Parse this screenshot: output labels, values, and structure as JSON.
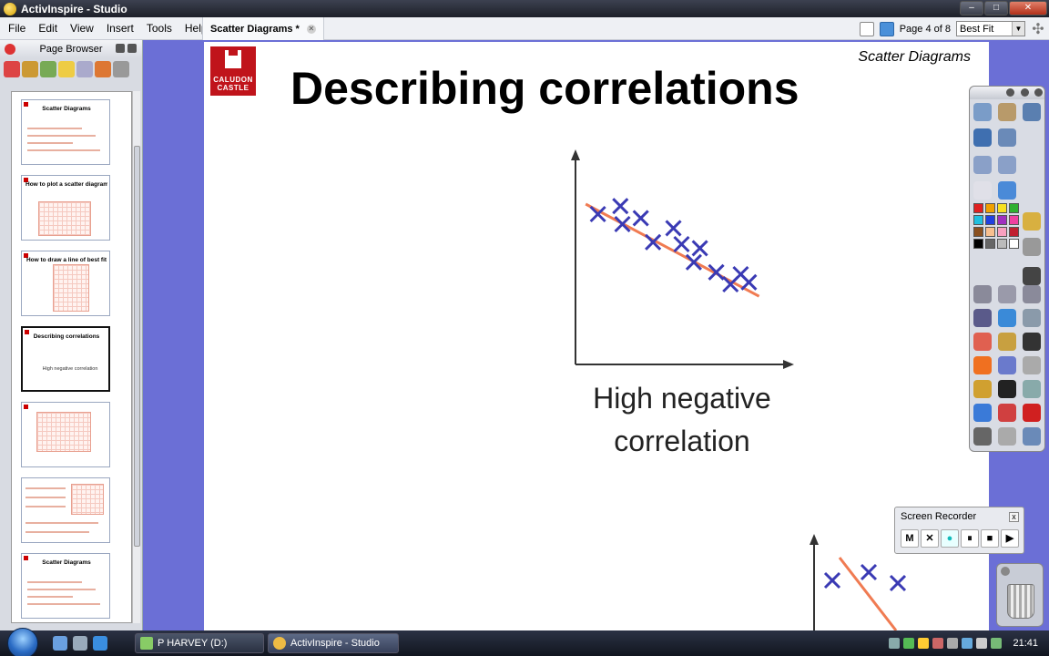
{
  "window": {
    "title": "ActivInspire - Studio"
  },
  "menu": {
    "items": [
      "File",
      "Edit",
      "View",
      "Insert",
      "Tools",
      "Help"
    ]
  },
  "document_tab": {
    "label": "Scatter Diagrams *"
  },
  "page_nav": {
    "label": "Page 4 of 8",
    "zoom": "Best Fit"
  },
  "page_browser": {
    "title": "Page Browser",
    "thumbnails": [
      {
        "title": "Scatter Diagrams"
      },
      {
        "title": "How to plot a scatter diagram"
      },
      {
        "title": "How to draw a line of best fit"
      },
      {
        "title": "Describing correlations",
        "caption": "High negative correlation",
        "active": true
      },
      {
        "title": ""
      },
      {
        "title": ""
      },
      {
        "title": "Scatter Diagrams"
      }
    ]
  },
  "slide": {
    "logo_text": [
      "CALUDON",
      "CASTLE"
    ],
    "header": "Scatter Diagrams",
    "title": "Describing correlations",
    "caption_line1": "High negative",
    "caption_line2": "correlation"
  },
  "chart_data": {
    "type": "scatter",
    "title": "Describing correlations",
    "caption": "High negative correlation",
    "x": [
      1.1,
      2.2,
      2.3,
      3.2,
      3.8,
      4.8,
      5.2,
      5.8,
      6.1,
      6.9,
      7.6,
      8.1,
      8.5
    ],
    "y": [
      7.5,
      7.9,
      7.0,
      7.3,
      6.1,
      6.8,
      6.0,
      5.1,
      5.8,
      4.6,
      4.0,
      4.5,
      4.1
    ],
    "best_fit_line": [
      [
        0.5,
        8.0
      ],
      [
        9.0,
        3.4
      ]
    ],
    "xlim": [
      0,
      10
    ],
    "ylim": [
      0,
      10
    ],
    "grid": false,
    "marker": "x",
    "colors": {
      "points": "#3a3ab4",
      "line": "#f07b52",
      "axes": "#333333"
    }
  },
  "partial_chart": {
    "x": [
      1.0,
      3.0,
      4.6
    ],
    "y": [
      6.5,
      7.4,
      6.2
    ],
    "best_fit_line": [
      [
        1.4,
        9.0
      ],
      [
        4.5,
        1.0
      ]
    ]
  },
  "recorder": {
    "title": "Screen Recorder",
    "buttons": [
      "M",
      "✕",
      "●",
      "⏸",
      "■",
      "▶"
    ]
  },
  "taskbar": {
    "tasks": [
      {
        "label": "P HARVEY (D:)"
      },
      {
        "label": "ActivInspire - Studio"
      }
    ],
    "clock": "21:41"
  },
  "colors": {
    "desktop": "#6b6fd6",
    "logo_red": "#c0141b"
  }
}
